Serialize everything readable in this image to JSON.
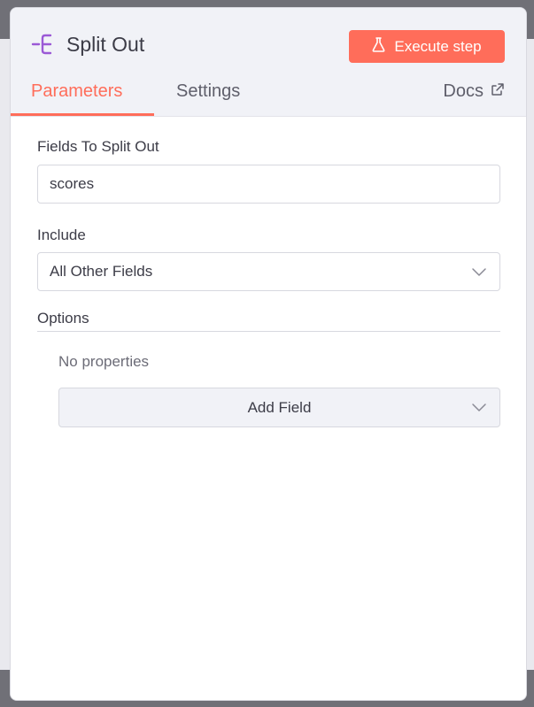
{
  "node": {
    "title": "Split Out",
    "icon": "split-out-icon",
    "accent_color": "#9b59d6"
  },
  "toolbar": {
    "execute_label": "Execute step",
    "execute_icon": "flask-icon",
    "execute_color": "#ff6d5a"
  },
  "tabs": [
    {
      "label": "Parameters",
      "active": true
    },
    {
      "label": "Settings",
      "active": false
    }
  ],
  "docs": {
    "label": "Docs",
    "icon": "external-link-icon"
  },
  "fields": {
    "split_out": {
      "label": "Fields To Split Out",
      "value": "scores"
    },
    "include": {
      "label": "Include",
      "value": "All Other Fields"
    }
  },
  "options": {
    "label": "Options",
    "empty_text": "No properties",
    "add_field_label": "Add Field"
  }
}
